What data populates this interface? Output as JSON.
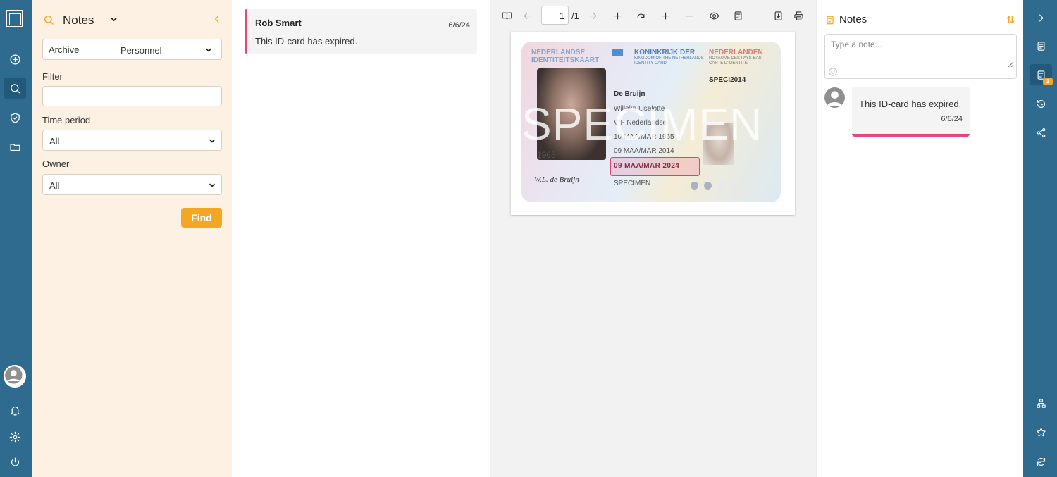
{
  "left_rail": {
    "items": [
      "logo-icon",
      "plus-circle-icon",
      "search-icon",
      "shield-icon",
      "folder-icon",
      "user-avatar-icon",
      "bell-icon",
      "gear-icon",
      "power-icon"
    ]
  },
  "search_panel": {
    "title": "Notes",
    "archive_label": "Archive",
    "archive_value": "Personnel",
    "filter_label": "Filter",
    "filter_value": "",
    "time_period_label": "Time period",
    "time_period_value": "All",
    "owner_label": "Owner",
    "owner_value": "All",
    "find_label": "Find",
    "accent_color": "#f5a623"
  },
  "results": [
    {
      "name": "Rob Smart",
      "date": "6/6/24",
      "text": "This ID-card has expired."
    }
  ],
  "viewer": {
    "page_current": "1",
    "page_total": "/1",
    "document": {
      "header_left_1": "NEDERLANDSE",
      "header_left_2": "IDENTITEITSKAART",
      "header_right_1": "KONINKRIJK DER",
      "header_right_2": "KINGDOM OF THE NETHERLANDS",
      "header_right_3": "IDENTITY CARD",
      "header_right2_1": "NEDERLANDEN",
      "header_right2_2": "ROYAUME DES PAYS-BAS",
      "header_right2_3": "CARTE D'IDENTITÉ",
      "doc_number": "SPECI2014",
      "surname": "De Bruijn",
      "given_names": "Willeke Liselotte",
      "sex_nationality": "V/F      Nederlandse",
      "birth_date": "10 MAA/MAR 1965",
      "issue_date": "09 MAA/MAR 2014",
      "expiry_date": "09 MAA/MAR 2024",
      "specimen_field": "SPECIMEN",
      "watermark": "SPECIMEN",
      "small_number": "1965",
      "signature": "W.L. de Bruijn"
    }
  },
  "notes_panel": {
    "title": "Notes",
    "input_placeholder": "Type a note...",
    "notes": [
      {
        "text": "This ID-card has expired.",
        "date": "6/6/24"
      }
    ],
    "highlight_color": "#e8457c"
  },
  "right_rail": {
    "items": [
      "chevron-right-icon",
      "document-icon",
      "notes-icon",
      "history-icon",
      "share-icon",
      "hierarchy-icon",
      "star-icon",
      "refresh-icon"
    ],
    "notes_badge": "1"
  }
}
